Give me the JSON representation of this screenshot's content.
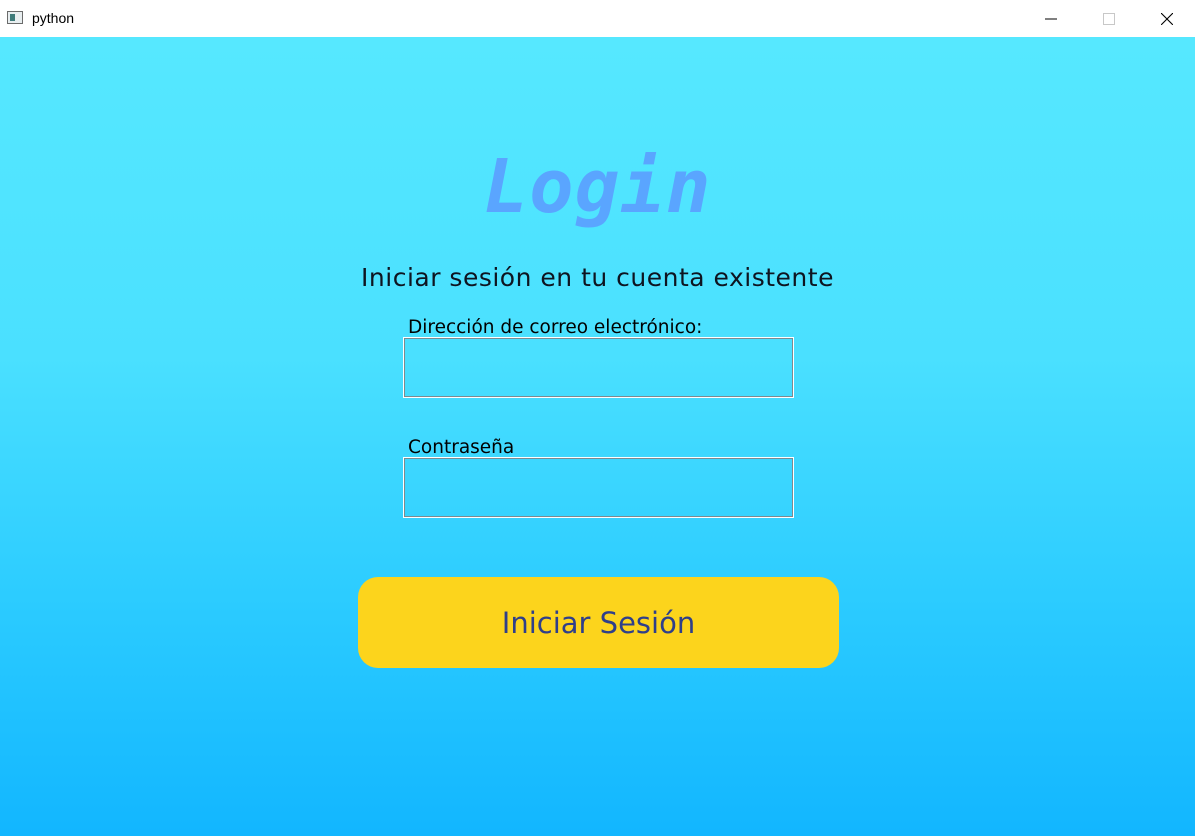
{
  "window": {
    "title": "python",
    "controls": {
      "minimize": "minimize-icon",
      "maximize": "maximize-icon",
      "close": "close-icon"
    }
  },
  "login": {
    "title": "Login",
    "subtitle": "Iniciar sesión en tu cuenta existente",
    "email": {
      "label": "Dirección de correo electrónico:",
      "value": "",
      "placeholder": ""
    },
    "password": {
      "label": "Contraseña",
      "value": "",
      "placeholder": ""
    },
    "submit_label": "Iniciar Sesión"
  },
  "colors": {
    "background_top": "#56e8ff",
    "background_bottom": "#12b6ff",
    "title": "#5aa5ff",
    "button_background": "#fcd41c",
    "button_text": "#2f3f8a"
  }
}
